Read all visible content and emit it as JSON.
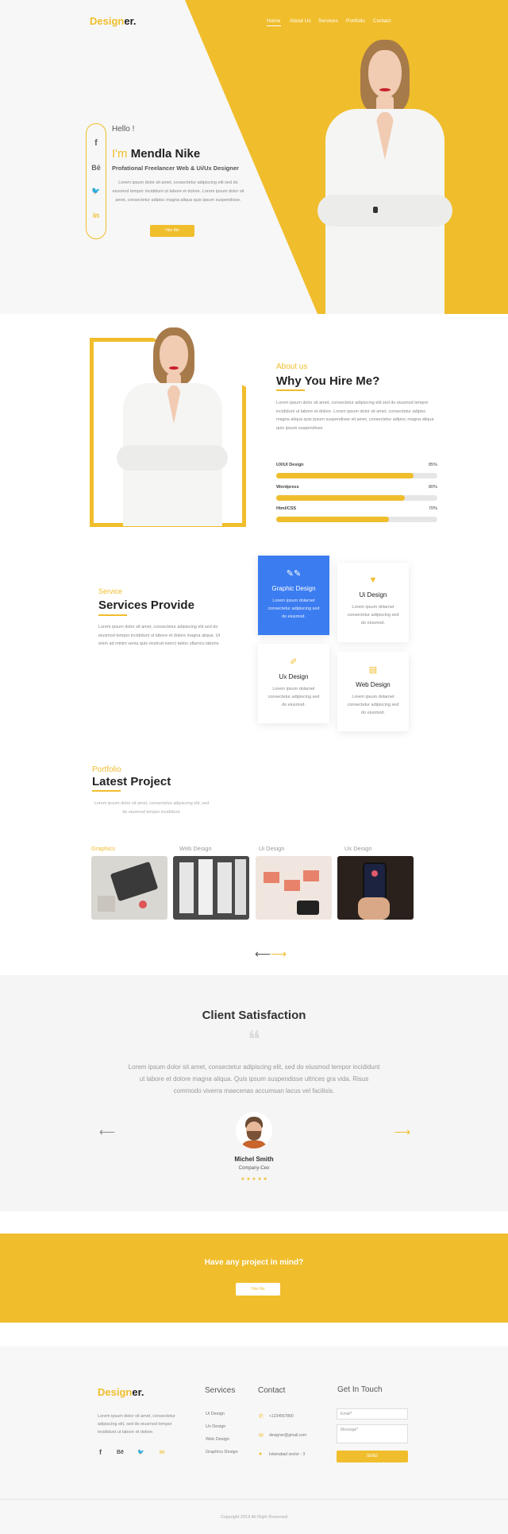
{
  "header": {
    "logo_a": "Design",
    "logo_b": "er.",
    "nav": [
      "Home",
      "About Us",
      "Services",
      "Portfolio",
      "Contact"
    ]
  },
  "hero": {
    "hello": "Hello !",
    "im": "I'm",
    "name": "Mendla Nike",
    "role": "Profational Freelancer Web & Ui/Ux  Designer",
    "text": "Lorem ipsum dolor sit amet, consectetur adipiscing elit sed do eiusmod tempor incididunt ut labore et dolore. Lorem ipsum dolor sit amet, consectetur adipisc magna aliqua quis ipsum suspendisse.",
    "button": "Hire Me",
    "social": [
      "f",
      "Bē",
      "🐦",
      "in"
    ]
  },
  "about": {
    "label": "About us",
    "title": "Why You Hire Me?",
    "text": "Lorem ipsum dolor sit amet, consectetur adipiscing elit sed do eiusmod tempor incididunt ut labore et dolore. Lorem ipsum dolor sit amet, consectetur adipisc magna aliqua quis ipsum suspendisse sit amet, consectetur adipisc magna aliqua quis ipsum suspendisse.",
    "skills": [
      {
        "name": "UX/UI Design",
        "pct_label": "85%",
        "value": 0.85
      },
      {
        "name": "Wordpress",
        "pct_label": "80%",
        "value": 0.8
      },
      {
        "name": "Html/CSS",
        "pct_label": "70%",
        "value": 0.7
      }
    ]
  },
  "services": {
    "label": "Service",
    "title": "Services Provide",
    "text": "Lorem ipsum dolor sit amet, consectetur adipiscing elit sed do eiusmod tempor incididunt ut labore et dolore magna aliqua. Ut enim ad minim venia  quis nostrud exerci tation ullamco laboris.",
    "cards": [
      {
        "title": "Graphic Design",
        "text": "Lorem ipsum dolarnet consectetur adipiscing sed do eiusmod.",
        "icon": "palette-icon"
      },
      {
        "title": "Ui Design",
        "text": "Lorem ipsum dolarnet consectetur adipiscing sed do eiusmod.",
        "icon": "brush-icon"
      },
      {
        "title": "Ux Design",
        "text": "Lorem ipsum dolarnet consectetur adipiscing sed do eiusmod.",
        "icon": "edit-icon"
      },
      {
        "title": "Web Design",
        "text": "Lorem ipsum dolarnet consectetur adipiscing sed do eiusmod.",
        "icon": "browser-icon"
      }
    ]
  },
  "portfolio": {
    "label": "Portfolio",
    "title": "Latest Project",
    "text": "Lorem ipsum dolor sit amet, consectetur adipiscing elit, sed do eiusmod tempor incididunt.",
    "tabs": [
      "Graphics",
      "Web Design",
      "Ui Design",
      "Ux Design"
    ],
    "prev": "⟵",
    "next": "⟶"
  },
  "testimonial": {
    "title": "Client Satisfaction",
    "quote_mark": "❝",
    "text": "Lorem ipsum dolor sit amet, consectetur adipiscing elit, sed do eiusmod tempor incididunt ut labore et dolore magna aliqua. Quis ipsum suspendisse ultrices gra vida. Risus commodo viverra maecenas accumsan lacus vel facilisis.",
    "name": "Michel Smith",
    "role": "Company-Ceo",
    "stars": "★ ★ ★ ★ ★",
    "prev": "⟵",
    "next": "⟶"
  },
  "cta": {
    "title": "Have any project in mind?",
    "button": "Hire Me"
  },
  "footer": {
    "logo_a": "Design",
    "logo_b": "er.",
    "about": "Lorem ipsum dolor sit amet, consectetur adipiscing elit, sed do eiusmod tempor incididunt ut labore et dolore.",
    "social": [
      "f",
      "Bē",
      "🐦",
      "in"
    ],
    "services_title": "Services",
    "services": [
      "Ui Design",
      "Ux Design",
      "Web Design",
      "Graphics Design"
    ],
    "contact_title": "Contact",
    "contact": [
      "+1234567890",
      "designer@gmail.com",
      "Islamabad sector - 3"
    ],
    "touch_title": "Get In Touch",
    "email_placeholder": "Email*",
    "message_placeholder": "Message*",
    "send": "SEND",
    "copyright": "Copyright 2019 All Right Reserved"
  },
  "colors": {
    "accent": "#f0bd2c",
    "active_card": "#3b7cf0"
  }
}
